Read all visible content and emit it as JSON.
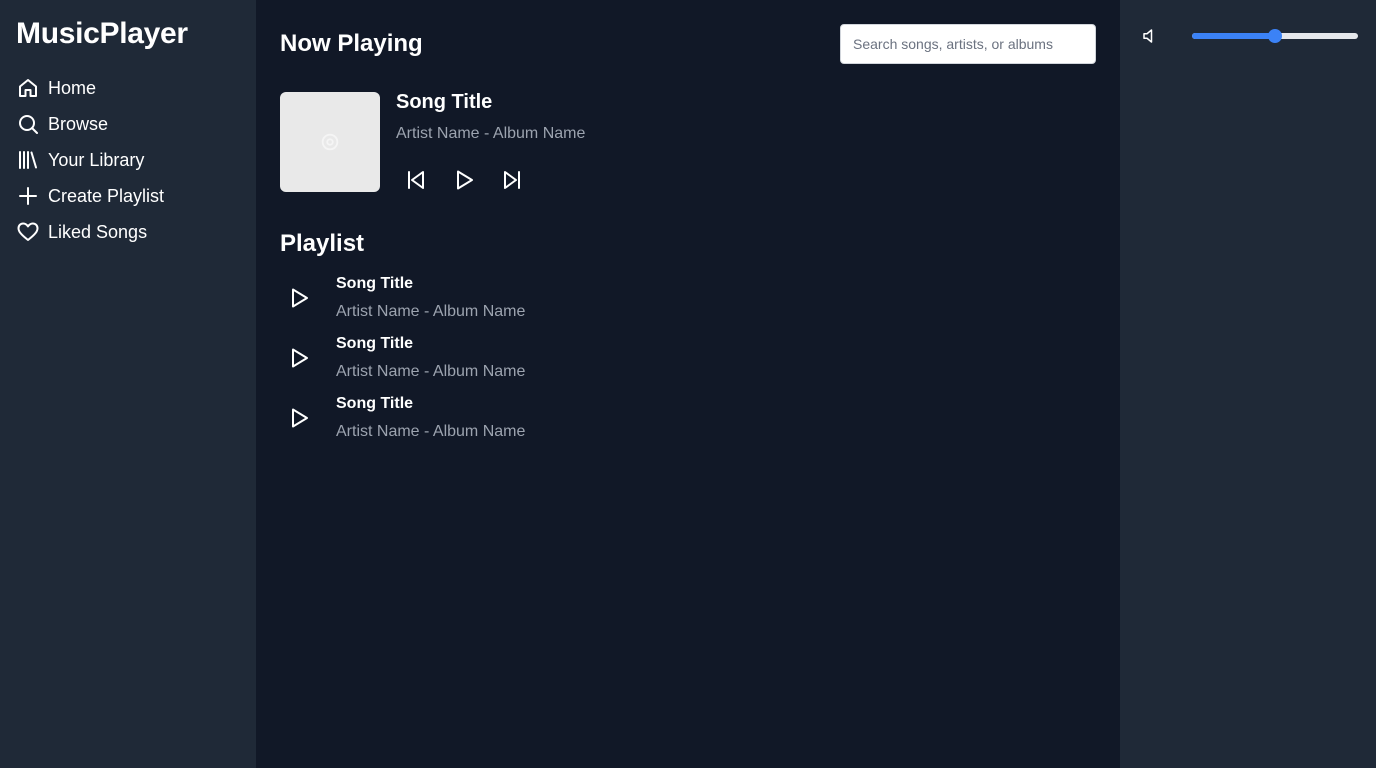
{
  "app": {
    "logo": "MusicPlayer"
  },
  "sidebar": {
    "items": [
      {
        "label": "Home",
        "icon": "home-icon"
      },
      {
        "label": "Browse",
        "icon": "search-icon"
      },
      {
        "label": "Your Library",
        "icon": "library-icon"
      },
      {
        "label": "Create Playlist",
        "icon": "plus-icon"
      },
      {
        "label": "Liked Songs",
        "icon": "heart-icon"
      }
    ]
  },
  "header": {
    "title": "Now Playing",
    "search_placeholder": "Search songs, artists, or albums"
  },
  "now_playing": {
    "title": "Song Title",
    "subtitle": "Artist Name - Album Name",
    "album_art_icon": "album-placeholder-icon",
    "controls": [
      "previous-icon",
      "play-icon",
      "next-icon"
    ]
  },
  "playlist": {
    "title": "Playlist",
    "tracks": [
      {
        "title": "Song Title",
        "subtitle": "Artist Name - Album Name"
      },
      {
        "title": "Song Title",
        "subtitle": "Artist Name - Album Name"
      },
      {
        "title": "Song Title",
        "subtitle": "Artist Name - Album Name"
      }
    ]
  },
  "volume": {
    "icon": "volume-icon",
    "level": 0.5
  },
  "colors": {
    "sidebar_bg": "#1f2937",
    "main_bg": "#111827",
    "accent": "#3b82f6",
    "muted_text": "#9ca3af"
  }
}
